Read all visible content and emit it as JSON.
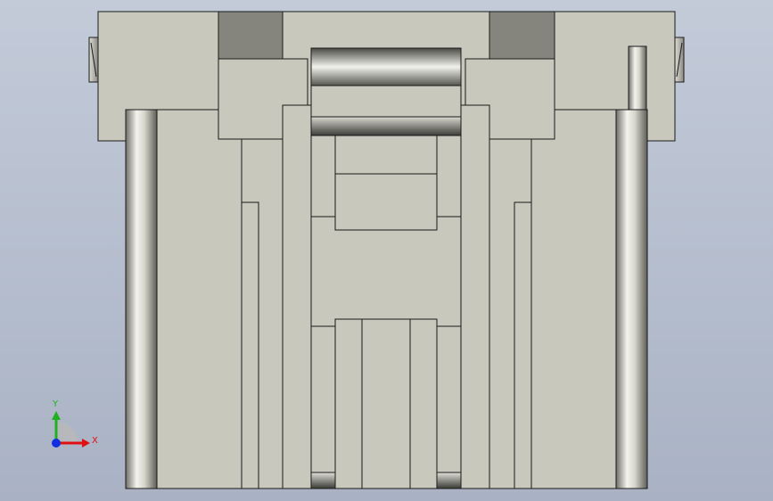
{
  "colors": {
    "part_face": "#c8c8bc",
    "part_edge": "#1a1a1a",
    "dark_face": "#85857d",
    "background_top": "#c3cbd9",
    "background_bottom": "#a9b2c4",
    "axis_x": "#e01010",
    "axis_y": "#20b020",
    "axis_z": "#1030e0"
  },
  "triad": {
    "x_label": "X",
    "y_label": "Y"
  }
}
